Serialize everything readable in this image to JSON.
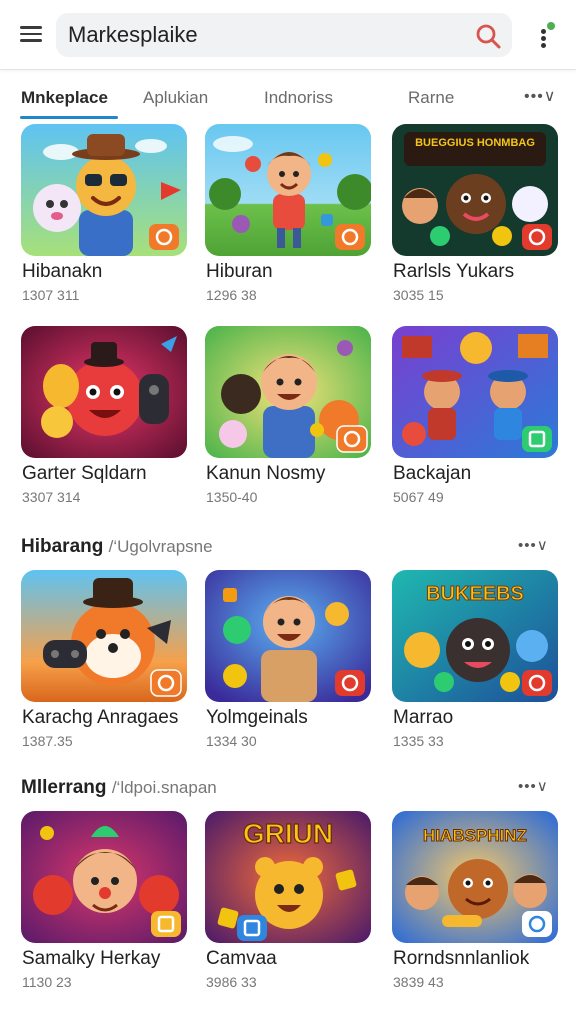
{
  "header": {
    "search_value": "Markesplaike",
    "menu_icon": "hamburger-menu-icon",
    "search_icon": "search-icon",
    "more_icon": "more-vert-icon",
    "notification_color": "#4caf50",
    "search_icon_color": "#d9534f"
  },
  "tabs": {
    "items": [
      {
        "label": "Mnkeplace"
      },
      {
        "label": "Aplukian"
      },
      {
        "label": "Indnoriss"
      },
      {
        "label": "Rarne"
      }
    ],
    "more_label": "•••∨",
    "active_color": "#1e88c8"
  },
  "sections": [
    {
      "cards": [
        {
          "title": "Hibanakn",
          "meta": "1307 311"
        },
        {
          "title": "Hiburan",
          "meta": "1296 38"
        },
        {
          "title": "Rarlsls Yukars",
          "meta": "3035 15"
        },
        {
          "title": "Garter Sqldarn",
          "meta": "3307 314"
        },
        {
          "title": "Kanun Nosmy",
          "meta": "1350-40"
        },
        {
          "title": "Backajan",
          "meta": "5067 49"
        }
      ]
    },
    {
      "title": "Hibarang",
      "subtitle": "/‘Ugolvrapsne",
      "more_label": "•••∨",
      "cards": [
        {
          "title": "Karachg Anragaes",
          "meta": "1387.35"
        },
        {
          "title": "Yolmgeinals",
          "meta": "1334 30"
        },
        {
          "title": "Marrao",
          "meta": "1335 33"
        }
      ]
    },
    {
      "title": "Mllerrang",
      "subtitle": "/‘ldpoi.snapan",
      "more_label": "•••∨",
      "cards": [
        {
          "title": "Samalky Herkay",
          "meta": "1130 23"
        },
        {
          "title": "Camvaa",
          "meta": "3986 33"
        },
        {
          "title": "Rorndsnnlanliok",
          "meta": "3839 43"
        }
      ]
    }
  ],
  "thumb_art": {
    "banner_text_1": "BUEGGIUS HONMBAG",
    "banner_text_2": "BUKEEBS",
    "banner_text_3": "GRIUN",
    "banner_text_4": "HIABSPHINZ"
  }
}
